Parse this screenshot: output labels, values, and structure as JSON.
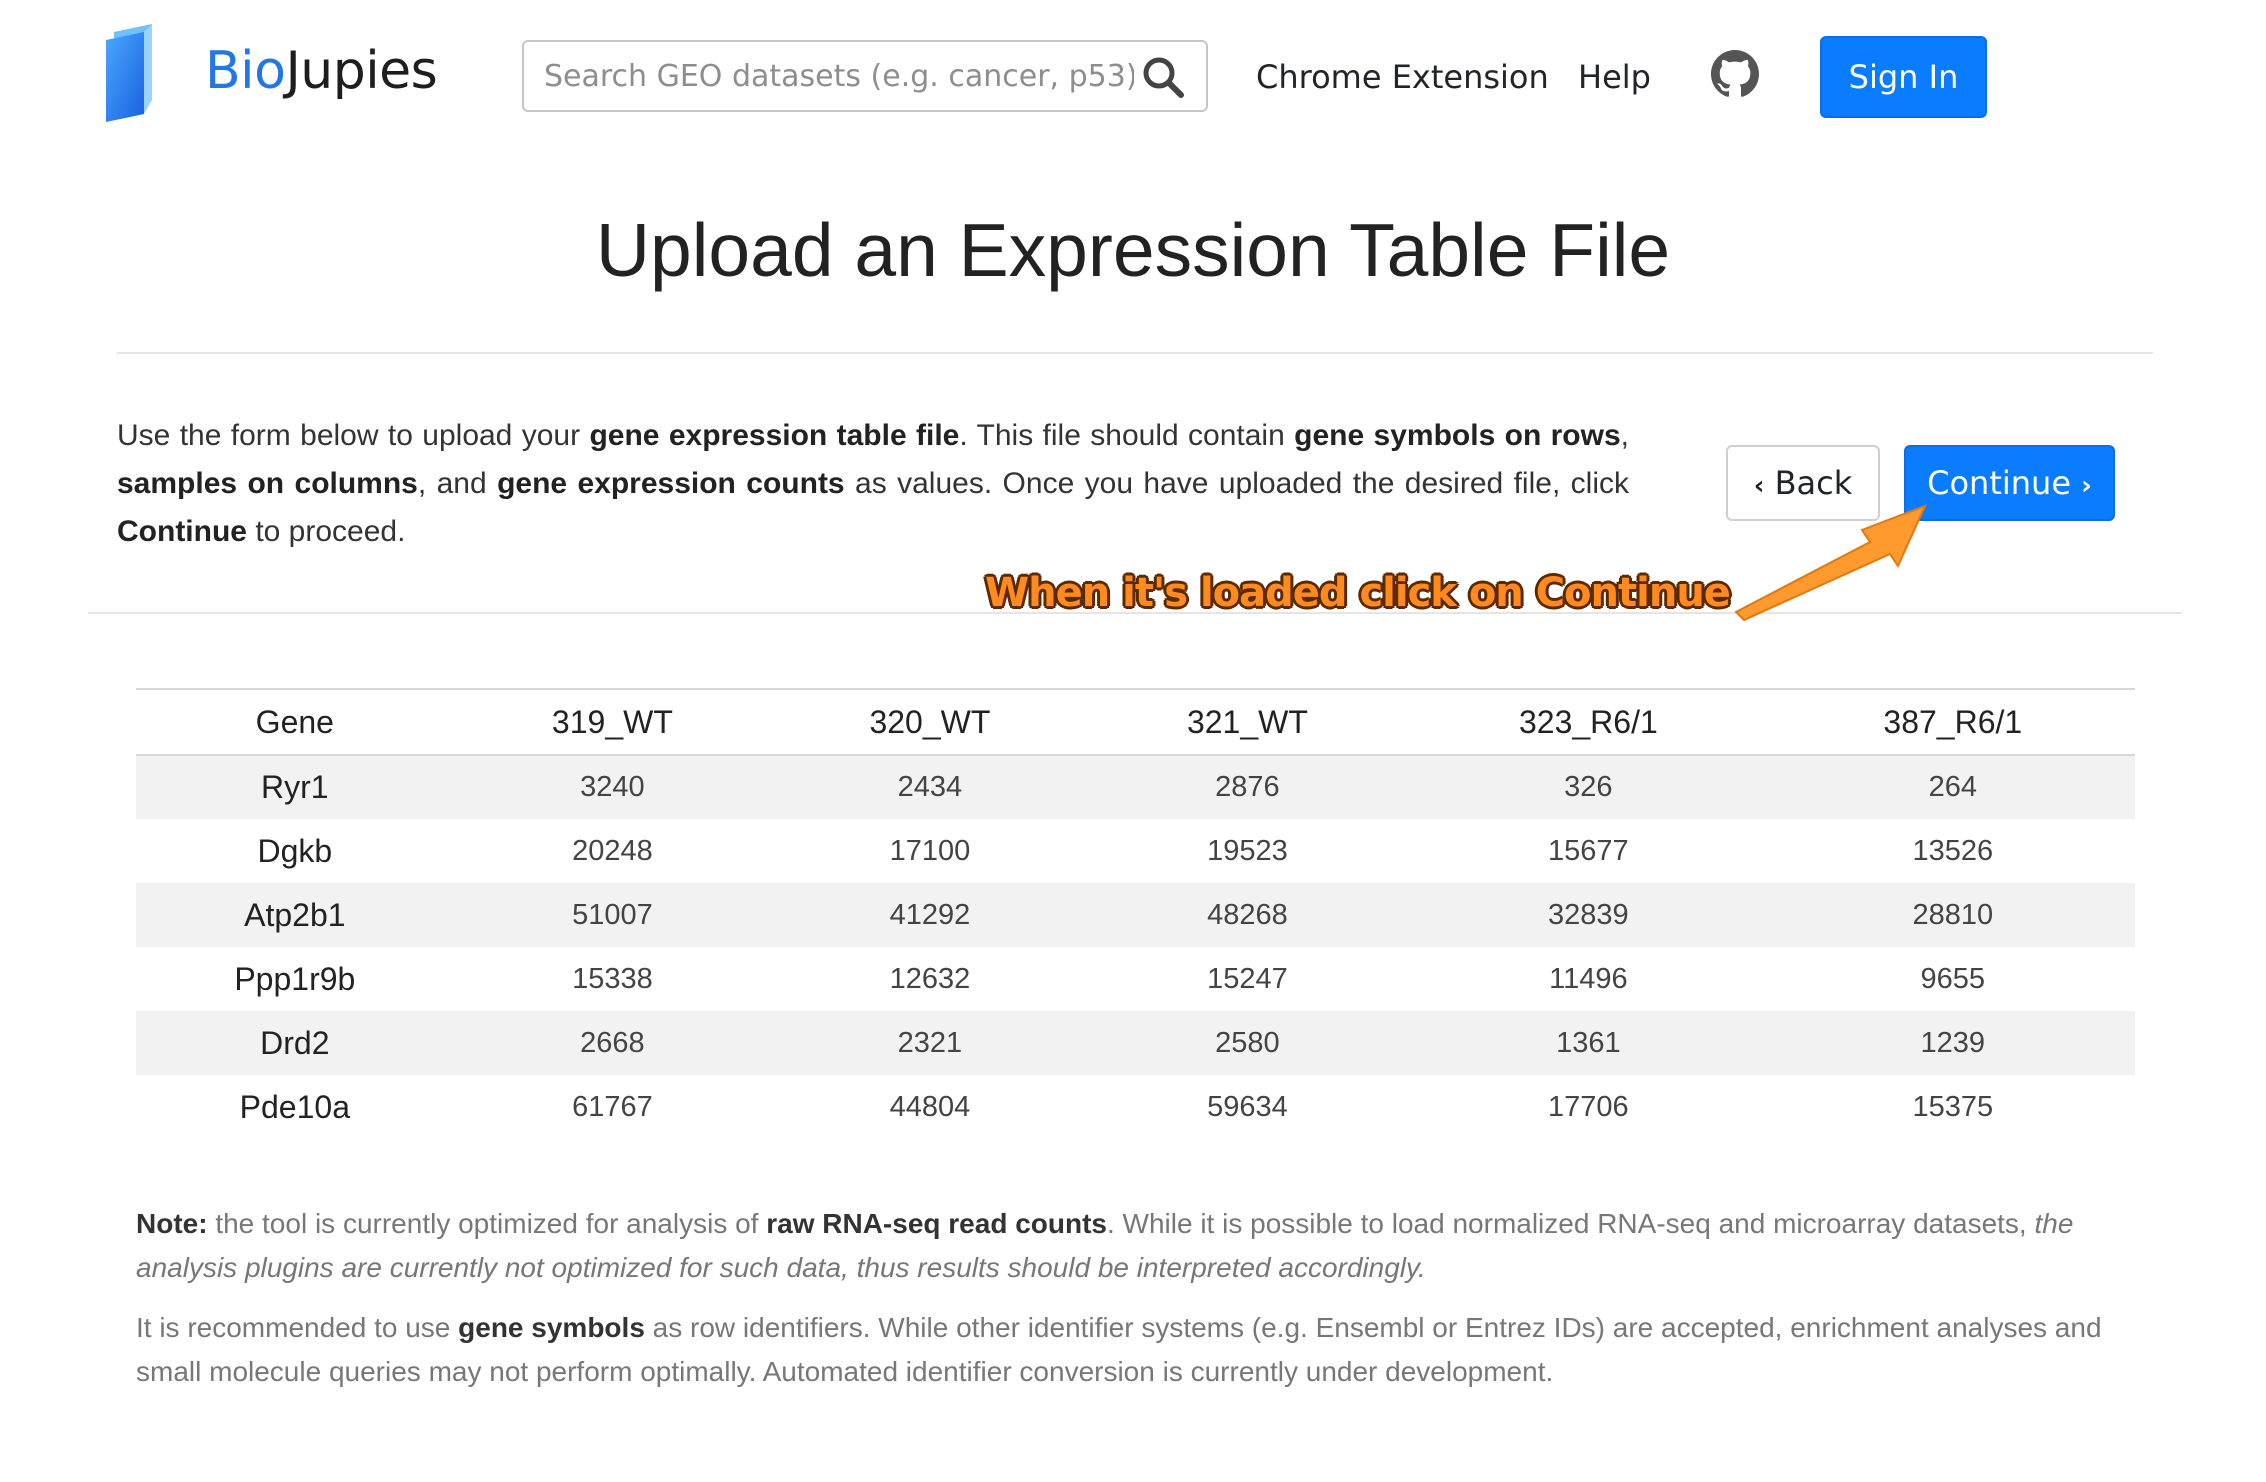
{
  "nav": {
    "brand_prefix": "Bio",
    "brand_suffix": "Jupies",
    "search_placeholder": "Search GEO datasets (e.g. cancer, p53)",
    "chrome_extension": "Chrome Extension",
    "help": "Help",
    "sign_in": "Sign In",
    "icons": {
      "logo": "book-logo-icon",
      "search": "search-icon",
      "github": "github-icon"
    }
  },
  "page": {
    "title": "Upload an Expression Table File"
  },
  "instructions": {
    "p1": "Use the form below to upload your ",
    "b1": "gene expression table file",
    "p2": ". This file should contain ",
    "b2": "gene symbols on rows",
    "p3": ", ",
    "b3": "samples on columns",
    "p4": ", and ",
    "b4": "gene expression counts",
    "p5": " as values. Once you have uploaded the desired file, click ",
    "b5": "Continue",
    "p6": " to proceed."
  },
  "buttons": {
    "back": "Back",
    "continue": "Continue",
    "back_icon": "chevron-left-icon",
    "continue_icon": "chevron-right-icon"
  },
  "annotation": {
    "text": "When it's loaded click on Continue",
    "color": "#ff8a1f"
  },
  "table": {
    "headers": [
      "Gene",
      "319_WT",
      "320_WT",
      "321_WT",
      "323_R6/1",
      "387_R6/1"
    ],
    "rows": [
      [
        "Ryr1",
        "3240",
        "2434",
        "2876",
        "326",
        "264"
      ],
      [
        "Dgkb",
        "20248",
        "17100",
        "19523",
        "15677",
        "13526"
      ],
      [
        "Atp2b1",
        "51007",
        "41292",
        "48268",
        "32839",
        "28810"
      ],
      [
        "Ppp1r9b",
        "15338",
        "12632",
        "15247",
        "11496",
        "9655"
      ],
      [
        "Drd2",
        "2668",
        "2321",
        "2580",
        "1361",
        "1239"
      ],
      [
        "Pde10a",
        "61767",
        "44804",
        "59634",
        "17706",
        "15375"
      ]
    ]
  },
  "notes": {
    "note_label": "Note:",
    "n1a": " the tool is currently optimized for analysis of ",
    "n1b": "raw RNA-seq read counts",
    "n1c": ". While it is possible to load normalized RNA-seq and microarray datasets, ",
    "n1d": "the analysis plugins are currently not optimized for such data, thus results should be interpreted accordingly.",
    "n2a": "It is recommended to use ",
    "n2b": "gene symbols",
    "n2c": " as row identifiers. While other identifier systems (e.g. Ensembl or Entrez IDs) are accepted, enrichment analyses and small molecule queries may not perform optimally. Automated identifier conversion is currently under development."
  },
  "colors": {
    "primary": "#0a7cff",
    "brand_blue": "#2277e6",
    "annotation_orange": "#ff8a1f"
  }
}
